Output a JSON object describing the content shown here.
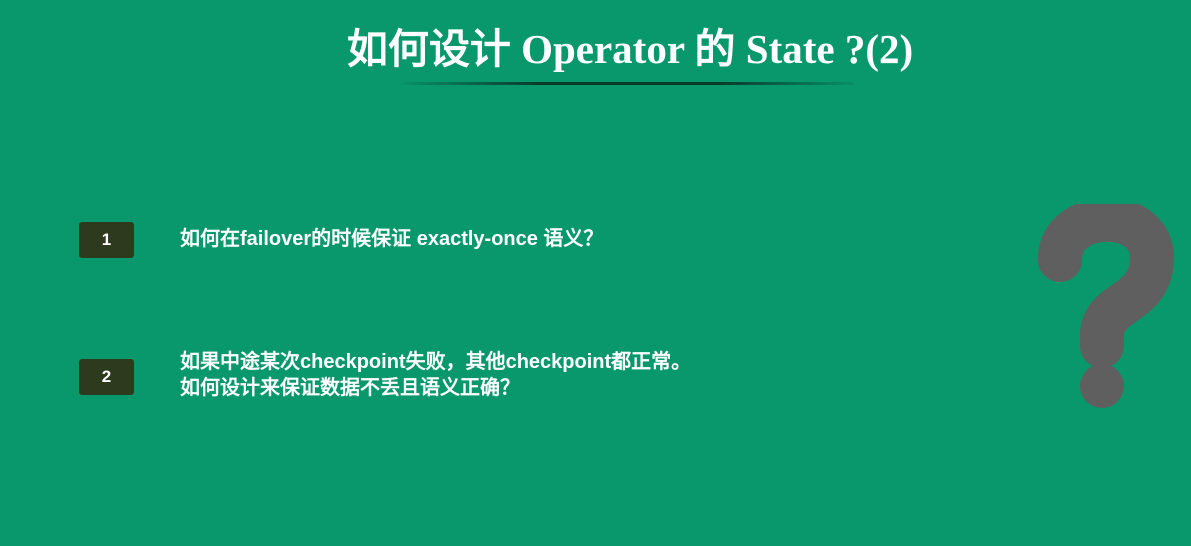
{
  "slide": {
    "title": "如何设计 Operator 的 State ?(2)"
  },
  "items": [
    {
      "number": "1",
      "lines": [
        "如何在failover的时候保证 exactly-once 语义？"
      ]
    },
    {
      "number": "2",
      "lines": [
        "如果中途某次checkpoint失败，其他checkpoint都正常。",
        "如何设计来保证数据不丢且语义正确？"
      ]
    }
  ],
  "decoration": {
    "icon": "question-mark-icon",
    "icon_color": "#5f5f5f"
  },
  "colors": {
    "background": "#08986b",
    "badge": "#2e3a1e",
    "text": "#ffffff"
  }
}
